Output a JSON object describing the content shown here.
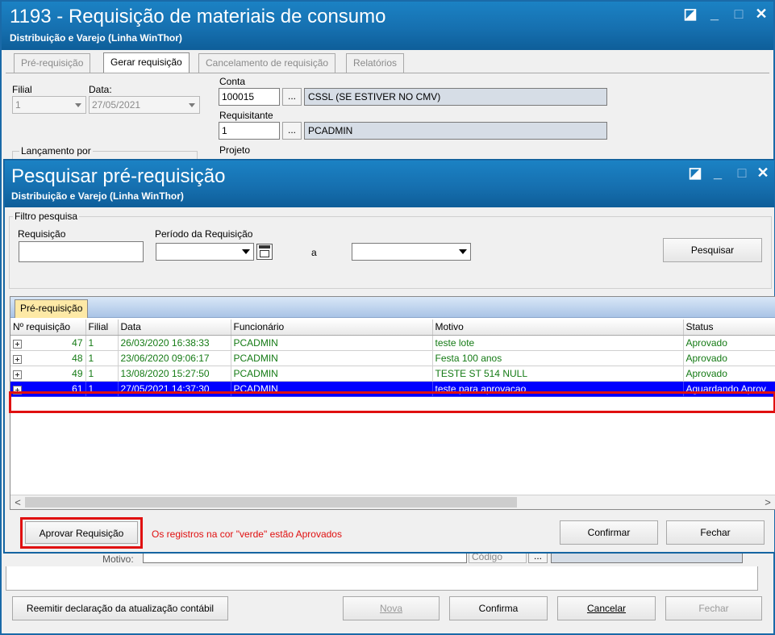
{
  "outer_window": {
    "title": "1193 - Requisição de materiais de consumo",
    "subtitle": "Distribuição e Varejo (Linha WinThor)",
    "controls": {
      "restore": "◪",
      "minimize": "_",
      "maximize": "□",
      "close": "✕"
    },
    "tabs": [
      "Pré-requisição",
      "Gerar requisição",
      "Cancelamento de requisição",
      "Relatórios"
    ],
    "active_tab": "Gerar requisição",
    "form": {
      "filial_label": "Filial",
      "filial_value": "1",
      "data_label": "Data:",
      "data_value": "27/05/2021",
      "conta_label": "Conta",
      "conta_value": "100015",
      "conta_desc": "CSSL (SE ESTIVER NO CMV)",
      "requisitante_label": "Requisitante",
      "requisitante_value": "1",
      "requisitante_desc": "PCADMIN",
      "projeto_label": "Projeto",
      "lancamento_label": "Lançamento por",
      "motivo_label": "Motivo:",
      "codigo_label": "Código",
      "dots": "..."
    },
    "bottom_buttons": {
      "reemitir": "Reemitir declaração da atualização contábil",
      "nova": "Nova",
      "confirma": "Confirma",
      "cancelar": "Cancelar",
      "fechar": "Fechar"
    }
  },
  "dialog": {
    "title": "Pesquisar pré-requisição",
    "subtitle": "Distribuição e Varejo (Linha WinThor)",
    "filter_group": "Filtro pesquisa",
    "requisicao_label": "Requisição",
    "periodo_label": "Período da Requisição",
    "a_label": "a",
    "pesquisar_button": "Pesquisar",
    "grid_tab": "Pré-requisição",
    "columns": [
      "Nº requisição",
      "Filial",
      "Data",
      "Funcionário",
      "Motivo",
      "Status"
    ],
    "rows": [
      {
        "num": "47",
        "filial": "1",
        "data": "26/03/2020 16:38:33",
        "funcionario": "PCADMIN",
        "motivo": "teste lote",
        "status": "Aprovado"
      },
      {
        "num": "48",
        "filial": "1",
        "data": "23/06/2020 09:06:17",
        "funcionario": "PCADMIN",
        "motivo": "Festa 100 anos",
        "status": "Aprovado"
      },
      {
        "num": "49",
        "filial": "1",
        "data": "13/08/2020 15:27:50",
        "funcionario": "PCADMIN",
        "motivo": "TESTE ST 514 NULL",
        "status": "Aprovado"
      },
      {
        "num": "61",
        "filial": "1",
        "data": "27/05/2021 14:37:30",
        "funcionario": "PCADMIN",
        "motivo": "teste para aprovacao",
        "status": "Aguardando Aprov"
      }
    ],
    "selected_row": 3,
    "aprovar_button": "Aprovar Requisição",
    "legend_text": "Os registros na cor \"verde\"  estão Aprovados",
    "confirmar_button": "Confirmar",
    "fechar_button": "Fechar",
    "colors": {
      "titlebar": "#1670b0",
      "approved_text": "#147a14",
      "selected_row": "#0000ff",
      "highlight": "#e01010",
      "legend_text": "#e01010"
    }
  }
}
